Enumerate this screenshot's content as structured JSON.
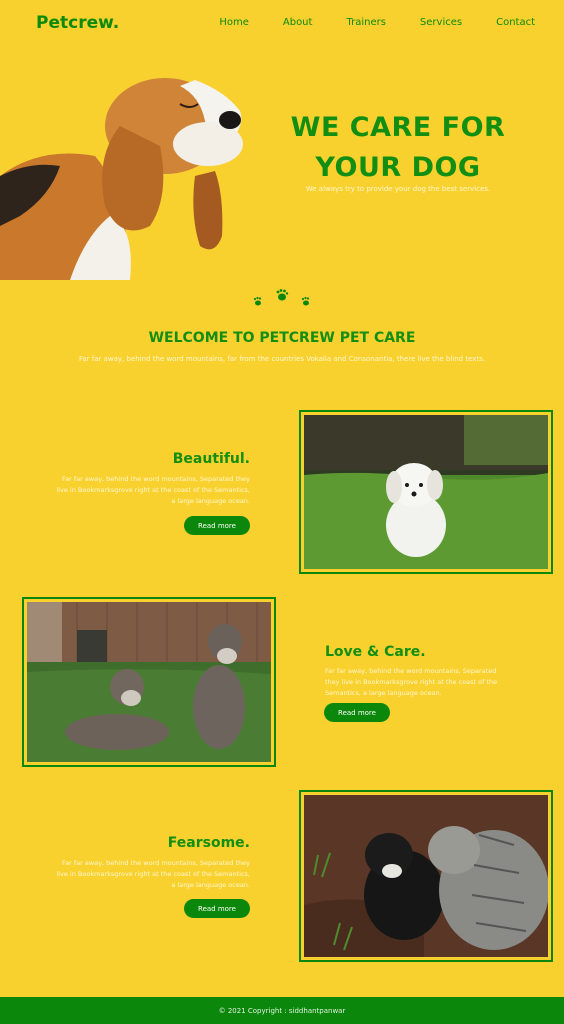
{
  "nav": {
    "brand": "Petcrew.",
    "items": [
      {
        "label": "Home"
      },
      {
        "label": "About"
      },
      {
        "label": "Trainers"
      },
      {
        "label": "Services"
      },
      {
        "label": "Contact"
      }
    ]
  },
  "hero": {
    "title_line1": "WE CARE FOR",
    "title_line2": "YOUR DOG",
    "subtitle": "We always try to provide your dog the best services."
  },
  "welcome": {
    "title": "WELCOME TO PETCREW PET CARE",
    "text": "Far far away, behind the word mountains, far from the countries Vokalia and Consonantia, there live the blind texts."
  },
  "features": [
    {
      "title": "Beautiful.",
      "text": "Far far away, behind the word mountains, Separated they live in Bookmarksgrove right at the coast of the Semantics, a large language ocean.",
      "button": "Read more"
    },
    {
      "title": "Love & Care.",
      "text": "Far far away, behind the word mountains, Separated they live in Bookmarksgrove right at the coast of the Semantics, a large language ocean.",
      "button": "Read more"
    },
    {
      "title": "Fearsome.",
      "text": "Far far away, behind the word mountains, Separated they live in Bookmarksgrove right at the coast of the Semantics, a large language ocean.",
      "button": "Read more"
    }
  ],
  "footer": {
    "copyright": "© 2021 Copyright : siddhantpanwar"
  },
  "colors": {
    "background": "#f9d12f",
    "accent": "#0b870b",
    "light_text": "#fff6cf"
  }
}
